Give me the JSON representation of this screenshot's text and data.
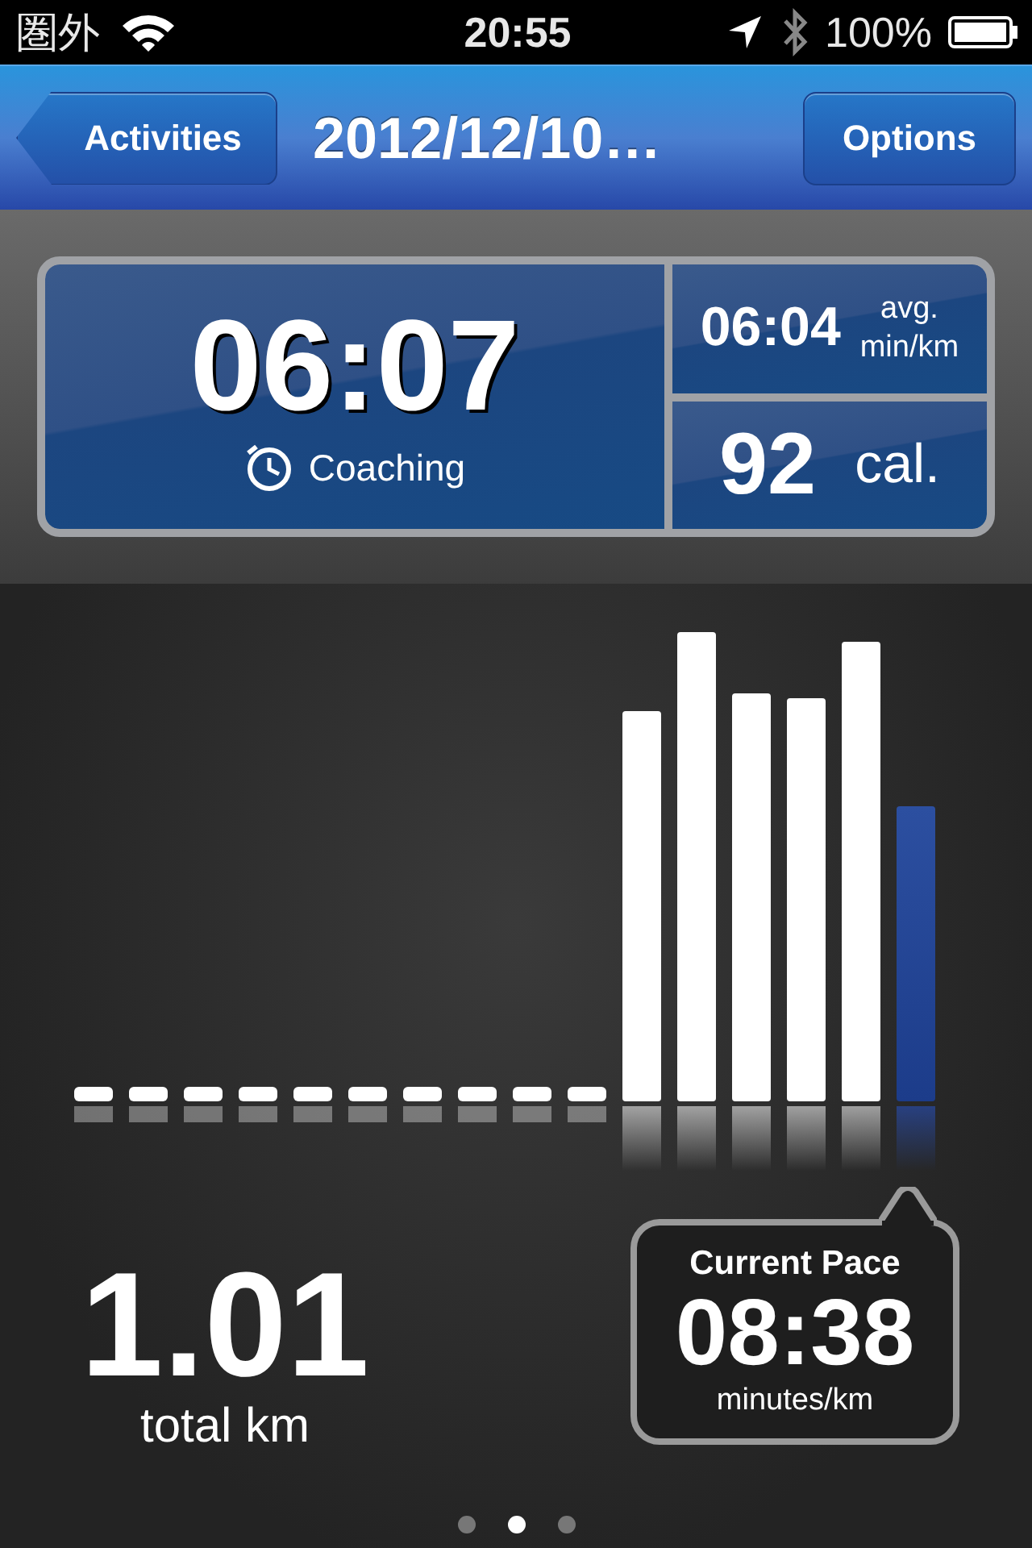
{
  "status_bar": {
    "carrier": "圏外",
    "time": "20:55",
    "battery": "100%"
  },
  "nav_bar": {
    "back_button": "Activities",
    "title": "2012/12/10…",
    "options_button": "Options"
  },
  "stats": {
    "duration": "06:07",
    "coaching": "Coaching",
    "avg_pace": "06:04",
    "avg_label": "avg.",
    "avg_unit": "min/km",
    "calories": "92",
    "calories_unit": "cal."
  },
  "pace_chart": {
    "bars": [
      {
        "selected": false
      },
      {
        "selected": false
      },
      {
        "selected": false
      },
      {
        "selected": false
      },
      {
        "selected": false
      },
      {
        "selected": false
      },
      {
        "selected": false
      },
      {
        "selected": false
      },
      {
        "selected": false
      },
      {
        "selected": false
      },
      {
        "selected": false
      },
      {
        "selected": false
      },
      {
        "selected": false
      },
      {
        "selected": false
      },
      {
        "selected": false
      },
      {
        "selected": true
      }
    ]
  },
  "distance": {
    "value": "1.01",
    "unit": "total km"
  },
  "current_pace": {
    "label": "Current Pace",
    "value": "08:38",
    "unit": "minutes/km"
  },
  "page_dots": [
    {
      "selected": false
    },
    {
      "selected": true
    },
    {
      "selected": false
    }
  ]
}
